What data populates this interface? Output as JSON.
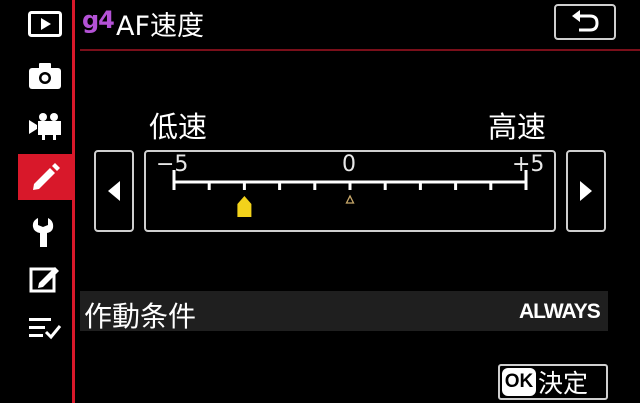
{
  "header": {
    "code": "g4",
    "title": "AF速度"
  },
  "slider": {
    "low_label": "低速",
    "high_label": "高速",
    "scale_min_label": "−5",
    "scale_mid_label": "0",
    "scale_max_label": "+5",
    "min": -5,
    "max": 5,
    "current_value": -3,
    "default_value": 0
  },
  "setting_row": {
    "label": "作動条件",
    "value": "ALWAYS"
  },
  "footer": {
    "ok_badge": "OK",
    "ok_label": "決定"
  },
  "sidebar": {
    "items": [
      {
        "icon": "playback-icon"
      },
      {
        "icon": "camera-icon"
      },
      {
        "icon": "movie-camera-icon"
      },
      {
        "icon": "pencil-icon",
        "active": true
      },
      {
        "icon": "wrench-icon"
      },
      {
        "icon": "retouch-icon"
      },
      {
        "icon": "my-menu-icon"
      }
    ]
  },
  "colors": {
    "accent_red": "#d8182a",
    "code_purple": "#b452d6",
    "indicator_yellow": "#f2d21b",
    "default_marker": "#c8a86a"
  }
}
